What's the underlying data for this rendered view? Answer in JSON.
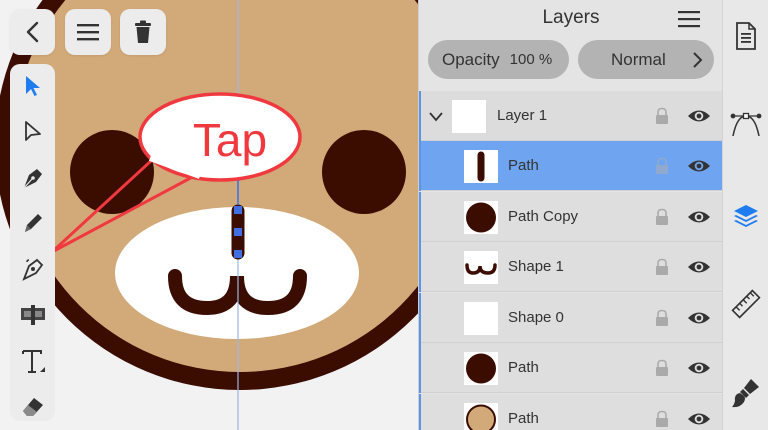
{
  "canvas": {
    "colors": {
      "face": "#d2aa79",
      "dark": "#3b0d00",
      "muzzle": "#ffffff",
      "guide": "#9bb6e0",
      "accent": "#3f6fe0",
      "annotation": "#f0393f"
    },
    "annotation_text": "Tap"
  },
  "top_buttons": [
    {
      "name": "back-button",
      "icon": "chevron-left-icon"
    },
    {
      "name": "menu-button",
      "icon": "hamburger-icon"
    },
    {
      "name": "delete-button",
      "icon": "trash-icon"
    }
  ],
  "tools": [
    {
      "name": "move-tool",
      "icon": "arrow-select-icon",
      "active": true
    },
    {
      "name": "node-tool",
      "icon": "arrow-direct-icon",
      "active": false
    },
    {
      "name": "pen-tool",
      "icon": "pen-nib-icon",
      "active": false
    },
    {
      "name": "pencil-tool",
      "icon": "pencil-icon",
      "active": false
    },
    {
      "name": "corner-tool",
      "icon": "corner-pen-icon",
      "active": false
    },
    {
      "name": "fill-tool",
      "icon": "gradient-fill-icon",
      "active": false
    },
    {
      "name": "text-tool",
      "icon": "text-T-icon",
      "active": false
    },
    {
      "name": "eraser-tool",
      "icon": "eraser-icon",
      "active": false
    }
  ],
  "layers_panel": {
    "title": "Layers",
    "opacity_label": "Opacity",
    "opacity_value": "100 %",
    "blend_mode": "Normal",
    "layers": [
      {
        "name": "Layer 1",
        "type": "group",
        "selected": false,
        "thumb": "blank"
      },
      {
        "name": "Path",
        "type": "item",
        "selected": true,
        "thumb": "vertical-bar"
      },
      {
        "name": "Path Copy",
        "type": "item",
        "selected": false,
        "thumb": "dark-circle"
      },
      {
        "name": "Shape 1",
        "type": "item",
        "selected": false,
        "thumb": "mouth"
      },
      {
        "name": "Shape 0",
        "type": "item",
        "selected": false,
        "thumb": "blank"
      },
      {
        "name": "Path",
        "type": "item",
        "selected": false,
        "thumb": "dark-circle"
      },
      {
        "name": "Path",
        "type": "item",
        "selected": false,
        "thumb": "tan-circle"
      }
    ]
  },
  "sidebar": [
    {
      "name": "document-button",
      "icon": "document-icon",
      "active": false
    },
    {
      "name": "path-edit-button",
      "icon": "bezier-path-icon",
      "active": false
    },
    {
      "name": "layers-button",
      "icon": "layers-stack-icon",
      "active": true
    },
    {
      "name": "ruler-button",
      "icon": "ruler-icon",
      "active": false
    },
    {
      "name": "style-button",
      "icon": "paintbrush-icon",
      "active": false
    }
  ]
}
